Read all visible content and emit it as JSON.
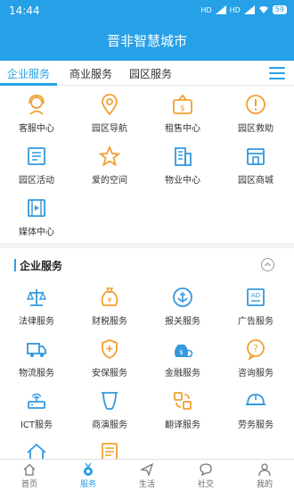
{
  "status_bar": {
    "time": "14:44",
    "signal_1": "HD",
    "signal_2": "HD",
    "battery": "59"
  },
  "title": "晋非智慧城市",
  "tabs": [
    {
      "label": "企业服务",
      "active": true
    },
    {
      "label": "商业服务",
      "active": false
    },
    {
      "label": "园区服务",
      "active": false
    }
  ],
  "top_grid": [
    {
      "label": "客服中心",
      "icon": "headset-icon"
    },
    {
      "label": "园区导航",
      "icon": "location-pin-icon"
    },
    {
      "label": "租售中心",
      "icon": "sale-sign-icon"
    },
    {
      "label": "园区救助",
      "icon": "alert-icon"
    },
    {
      "label": "园区活动",
      "icon": "newspaper-icon"
    },
    {
      "label": "爱的空间",
      "icon": "star-icon"
    },
    {
      "label": "物业中心",
      "icon": "building-icon"
    },
    {
      "label": "园区商城",
      "icon": "storefront-icon"
    },
    {
      "label": "媒体中心",
      "icon": "film-icon"
    }
  ],
  "section": {
    "title": "企业服务"
  },
  "section_grid": [
    {
      "label": "法律服务",
      "icon": "scales-icon"
    },
    {
      "label": "财税服务",
      "icon": "money-bag-icon"
    },
    {
      "label": "报关服务",
      "icon": "anchor-icon"
    },
    {
      "label": "广告服务",
      "icon": "ad-board-icon"
    },
    {
      "label": "物流服务",
      "icon": "truck-icon"
    },
    {
      "label": "安保服务",
      "icon": "shield-icon"
    },
    {
      "label": "金融服务",
      "icon": "coin-bag-icon"
    },
    {
      "label": "咨询服务",
      "icon": "question-bubble-icon"
    },
    {
      "label": "ICT服务",
      "icon": "router-icon"
    },
    {
      "label": "商演服务",
      "icon": "stage-icon"
    },
    {
      "label": "翻译服务",
      "icon": "translate-icon"
    },
    {
      "label": "劳务服务",
      "icon": "helmet-icon"
    },
    {
      "label": "",
      "icon": "house-icon"
    },
    {
      "label": "",
      "icon": "document-icon"
    }
  ],
  "bottom_nav": [
    {
      "label": "首页",
      "icon": "home-icon",
      "active": false
    },
    {
      "label": "服务",
      "icon": "medal-icon",
      "active": true
    },
    {
      "label": "生活",
      "icon": "send-icon",
      "active": false
    },
    {
      "label": "社交",
      "icon": "chat-icon",
      "active": false
    },
    {
      "label": "我的",
      "icon": "user-icon",
      "active": false
    }
  ],
  "colors": {
    "primary": "#26a0e6",
    "icon_orange": "#f0a030",
    "icon_blue": "#3399dd"
  }
}
